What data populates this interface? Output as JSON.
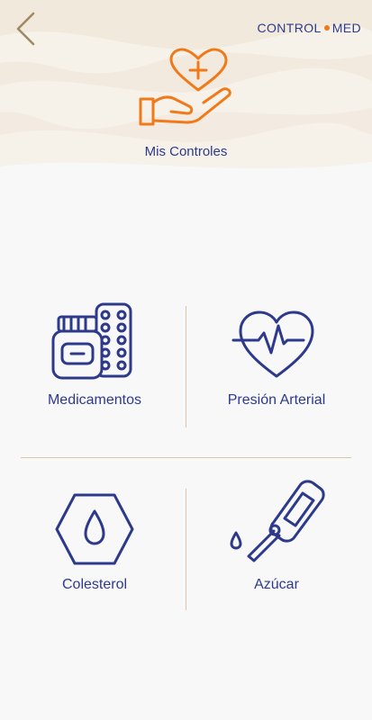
{
  "header": {
    "back_icon": "chevron-left-icon",
    "logo_left": "CONTROL",
    "logo_right": "MED",
    "title": "Mis Controles",
    "title_icon": "hand-heart-plus-icon"
  },
  "tiles": [
    {
      "label": "Medicamentos",
      "icon": "medication-icon"
    },
    {
      "label": "Presión Arterial",
      "icon": "heart-pulse-icon"
    },
    {
      "label": "Colesterol",
      "icon": "drop-hexagon-icon"
    },
    {
      "label": "Azúcar",
      "icon": "glucometer-icon"
    }
  ],
  "colors": {
    "primary": "#2d3a8c",
    "accent": "#f07a1a",
    "divider": "#d9c7ad",
    "header_back": "#a18a62"
  }
}
